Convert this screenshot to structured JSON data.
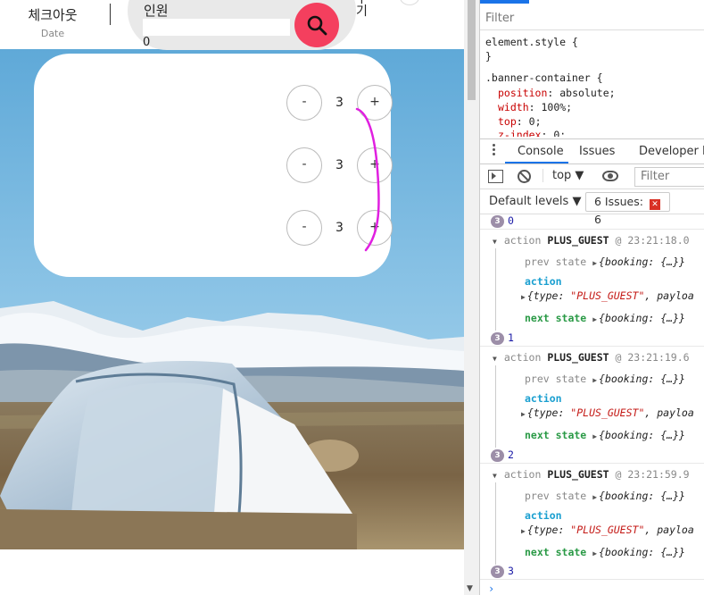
{
  "header": {
    "checkout_title": "체크아웃",
    "checkout_sub": "Date",
    "guests_label": "인원",
    "guests_value": "0",
    "cut_text": "무\n기"
  },
  "guest_panel": {
    "rows": [
      {
        "minus": "-",
        "count": "3",
        "plus": "+"
      },
      {
        "minus": "-",
        "count": "3",
        "plus": "+"
      },
      {
        "minus": "-",
        "count": "3",
        "plus": "+"
      }
    ]
  },
  "colors": {
    "search_button": "#f43f5e",
    "annotation_stroke": "#e020e0"
  },
  "devtools": {
    "styles_filter_placeholder": "Filter",
    "css_rules": [
      {
        "text": "element.style {"
      },
      {
        "text": "}"
      },
      {
        "text": ".banner-container {"
      },
      {
        "prop": "position",
        "val": "absolute;"
      },
      {
        "prop": "width",
        "val": "100%;"
      },
      {
        "prop": "top",
        "val": "0;"
      },
      {
        "prop": "z-index",
        "val": "0;"
      }
    ],
    "tabs": [
      "Console",
      "Issues",
      "Developer Re"
    ],
    "context": "top ▼",
    "console_filter_placeholder": "Filter",
    "levels": "Default levels ▼",
    "issues_label": "6 Issues:",
    "issues_count": "6",
    "log": {
      "first_count": {
        "badge": "3",
        "value": "0"
      },
      "groups": [
        {
          "action_word": "action",
          "action_type": "PLUS_GUEST",
          "time": "@ 23:21:18.0",
          "prev_state": "{booking: {…}}",
          "action_obj_prefix": "{type: ",
          "action_obj_type": "\"PLUS_GUEST\"",
          "action_obj_suffix": ", payloa",
          "next_state": "{booking: {…}}",
          "after": {
            "badge": "3",
            "value": "1"
          }
        },
        {
          "action_word": "action",
          "action_type": "PLUS_GUEST",
          "time": "@ 23:21:19.6",
          "prev_state": "{booking: {…}}",
          "action_obj_prefix": "{type: ",
          "action_obj_type": "\"PLUS_GUEST\"",
          "action_obj_suffix": ", payloa",
          "next_state": "{booking: {…}}",
          "after": {
            "badge": "3",
            "value": "2"
          }
        },
        {
          "action_word": "action",
          "action_type": "PLUS_GUEST",
          "time": "@ 23:21:59.9",
          "prev_state": "{booking: {…}}",
          "action_obj_prefix": "{type: ",
          "action_obj_type": "\"PLUS_GUEST\"",
          "action_obj_suffix": ", payloa",
          "next_state": "{booking: {…}}",
          "after": {
            "badge": "3",
            "value": "3"
          }
        }
      ],
      "prev_state_key": "prev state",
      "action_key": "action",
      "next_state_key": "next state",
      "prompt": "›"
    }
  }
}
